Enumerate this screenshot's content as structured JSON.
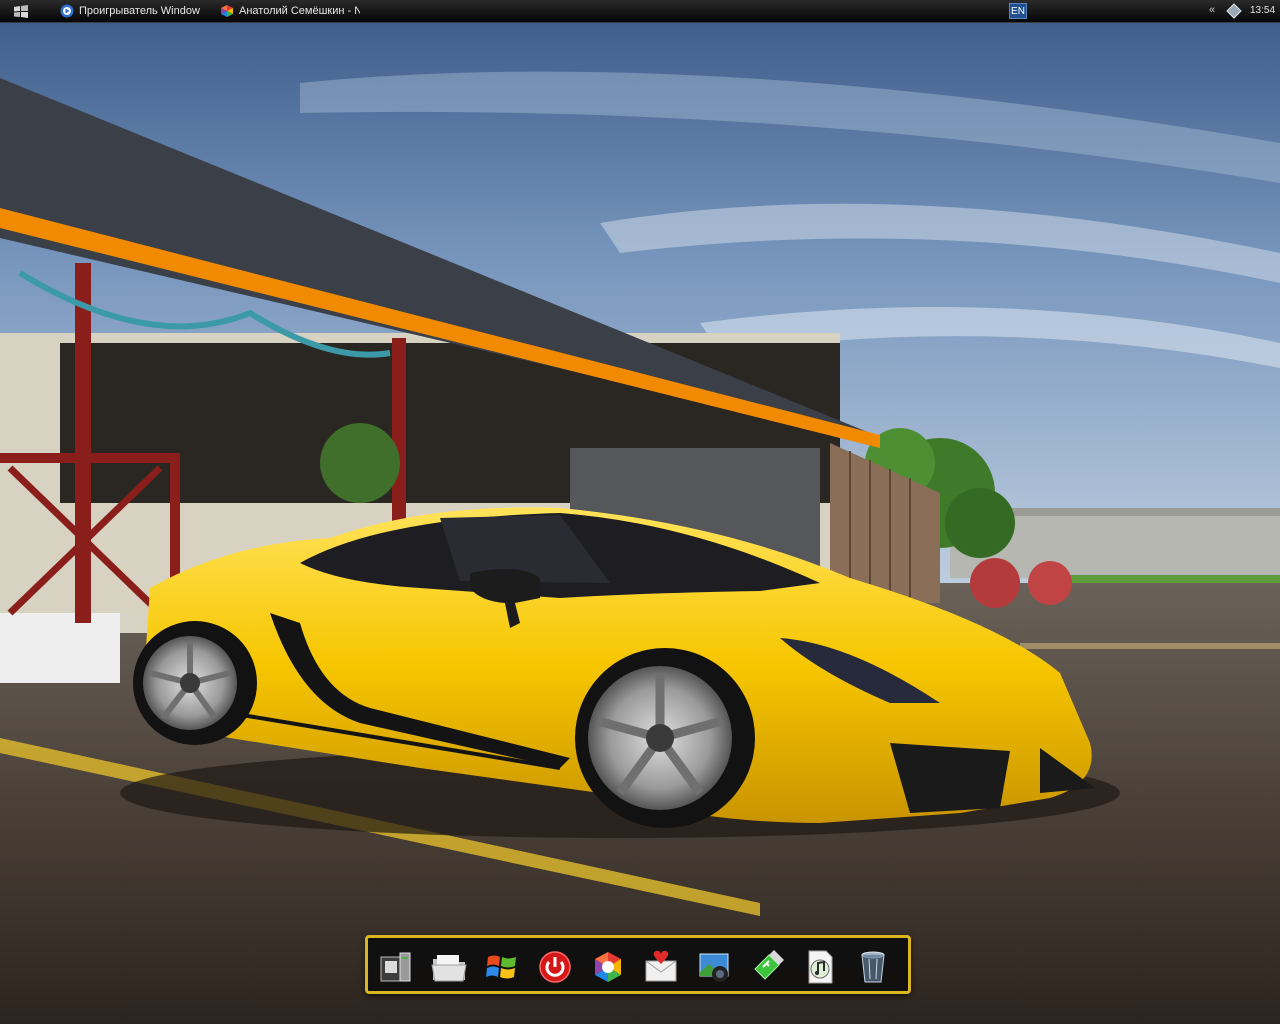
{
  "taskbar": {
    "tasks": [
      {
        "label": "Проигрыватель Windows...",
        "icon": "windows-media-player-icon"
      },
      {
        "label": "Анатолий Семёшкин - Ni...",
        "icon": "browser-icon"
      }
    ],
    "language": "EN",
    "tray_arrow": "«",
    "clock": "13:54"
  },
  "dock": {
    "items": [
      {
        "name": "computer",
        "icon": "computer-icon"
      },
      {
        "name": "documents",
        "icon": "folder-icon"
      },
      {
        "name": "windows",
        "icon": "windows-logo-icon"
      },
      {
        "name": "shutdown",
        "icon": "power-icon"
      },
      {
        "name": "browser",
        "icon": "browser-icon"
      },
      {
        "name": "mail",
        "icon": "mail-heart-icon"
      },
      {
        "name": "photos",
        "icon": "camera-icon"
      },
      {
        "name": "usb",
        "icon": "usb-icon"
      },
      {
        "name": "music",
        "icon": "music-file-icon"
      },
      {
        "name": "recycle-bin",
        "icon": "recycle-bin-icon"
      }
    ]
  },
  "wallpaper": {
    "subject": "yellow-sports-car",
    "colors": {
      "sky": "#6f8db4",
      "car": "#f7c600",
      "roof_trim": "#f28a00"
    }
  }
}
